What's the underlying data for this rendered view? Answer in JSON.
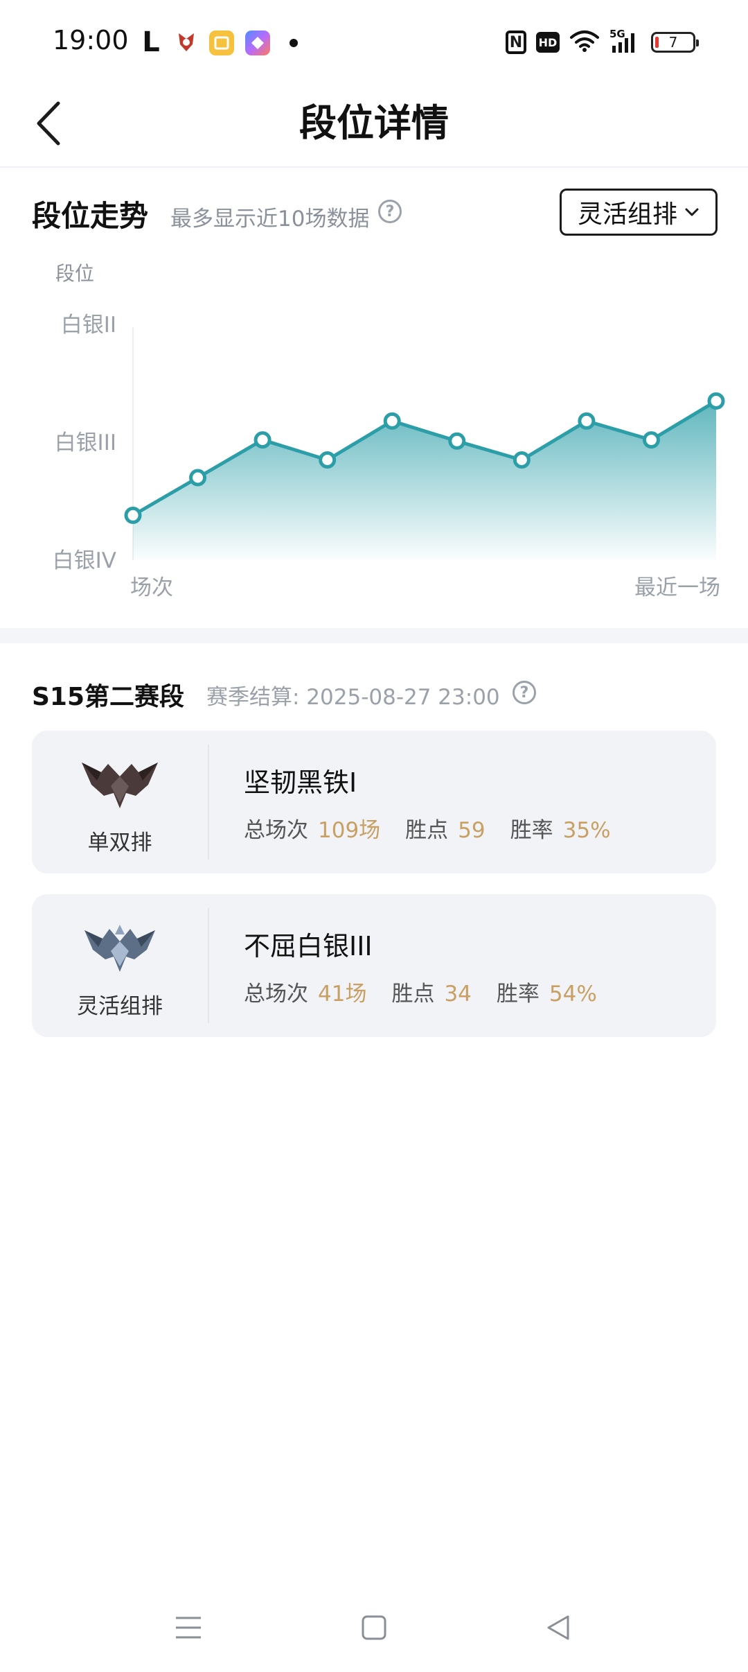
{
  "status_bar": {
    "time": "19:00",
    "left_letter": "L",
    "network": "5G",
    "hd": "HD",
    "nfc": "N",
    "battery": "7"
  },
  "header": {
    "title": "段位详情"
  },
  "trend": {
    "title": "段位走势",
    "subtitle": "最多显示近10场数据",
    "mode_select": "灵活组排"
  },
  "chart_data": {
    "type": "area",
    "title": "",
    "ylabel": "段位",
    "y_ticks": [
      "白银II",
      "白银III",
      "白银IV"
    ],
    "x_labels": [
      "场次",
      "最近一场"
    ],
    "ylim": [
      0,
      2
    ],
    "y_tick_values": [
      2,
      1,
      0
    ],
    "series": [
      {
        "values": [
          0.38,
          0.7,
          1.02,
          0.85,
          1.18,
          1.01,
          0.85,
          1.18,
          1.02,
          1.35
        ]
      }
    ],
    "colors": {
      "line": "#2b9ea8",
      "fill": "#5bb7bd"
    },
    "grid": false
  },
  "season": {
    "title": "S15第二赛段",
    "settlement": "赛季结算: 2025-08-27 23:00"
  },
  "ranks": [
    {
      "queue": "单双排",
      "rank": "坚韧黑铁I",
      "games_label": "总场次",
      "games": "109场",
      "lp_label": "胜点",
      "lp": "59",
      "winrate_label": "胜率",
      "winrate": "35%",
      "emblem": "iron-emblem-icon"
    },
    {
      "queue": "灵活组排",
      "rank": "不屈白银III",
      "games_label": "总场次",
      "games": "41场",
      "lp_label": "胜点",
      "lp": "34",
      "winrate_label": "胜率",
      "winrate": "54%",
      "emblem": "silver-emblem-icon"
    }
  ],
  "colors": {
    "accent_value": "#c9a064",
    "chart_line": "#2b9ea8",
    "card_bg": "#f1f3f7"
  }
}
